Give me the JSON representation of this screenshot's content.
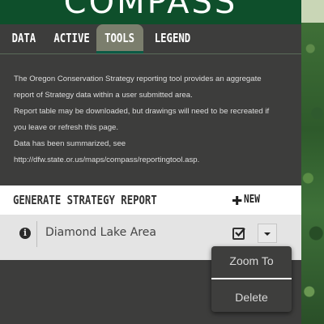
{
  "header": {
    "title": "COMPASS"
  },
  "tabs": [
    {
      "label": "DATA"
    },
    {
      "label": "ACTIVE"
    },
    {
      "label": "TOOLS"
    },
    {
      "label": "LEGEND"
    }
  ],
  "tools": {
    "description": [
      "The Oregon Conservation Strategy reporting tool provides an aggregate",
      "report of Strategy data within a user submitted area.",
      "Report table may be downloaded, but drawings will need to be recreated if",
      "you leave or refresh this page.",
      "Data has been summarized, see",
      "http://dfw.state.or.us/maps/compass/reportingtool.asp."
    ],
    "report_title": "GENERATE STRATEGY REPORT",
    "new_button": "NEW",
    "reports": [
      {
        "name": "Diamond Lake Area"
      }
    ],
    "menu": [
      {
        "label": "Zoom To"
      },
      {
        "label": "Delete"
      }
    ]
  },
  "icons": {
    "info": "info-circle-icon",
    "plus": "plus-icon",
    "checkbox": "checkbox-checked-icon",
    "dropdown": "caret-down-icon"
  },
  "colors": {
    "header_bg": "#0e4f2b",
    "panel_bg": "#3d3d3c",
    "active_tab": "#7b7e6d",
    "row_bg": "#e4e4e4"
  }
}
